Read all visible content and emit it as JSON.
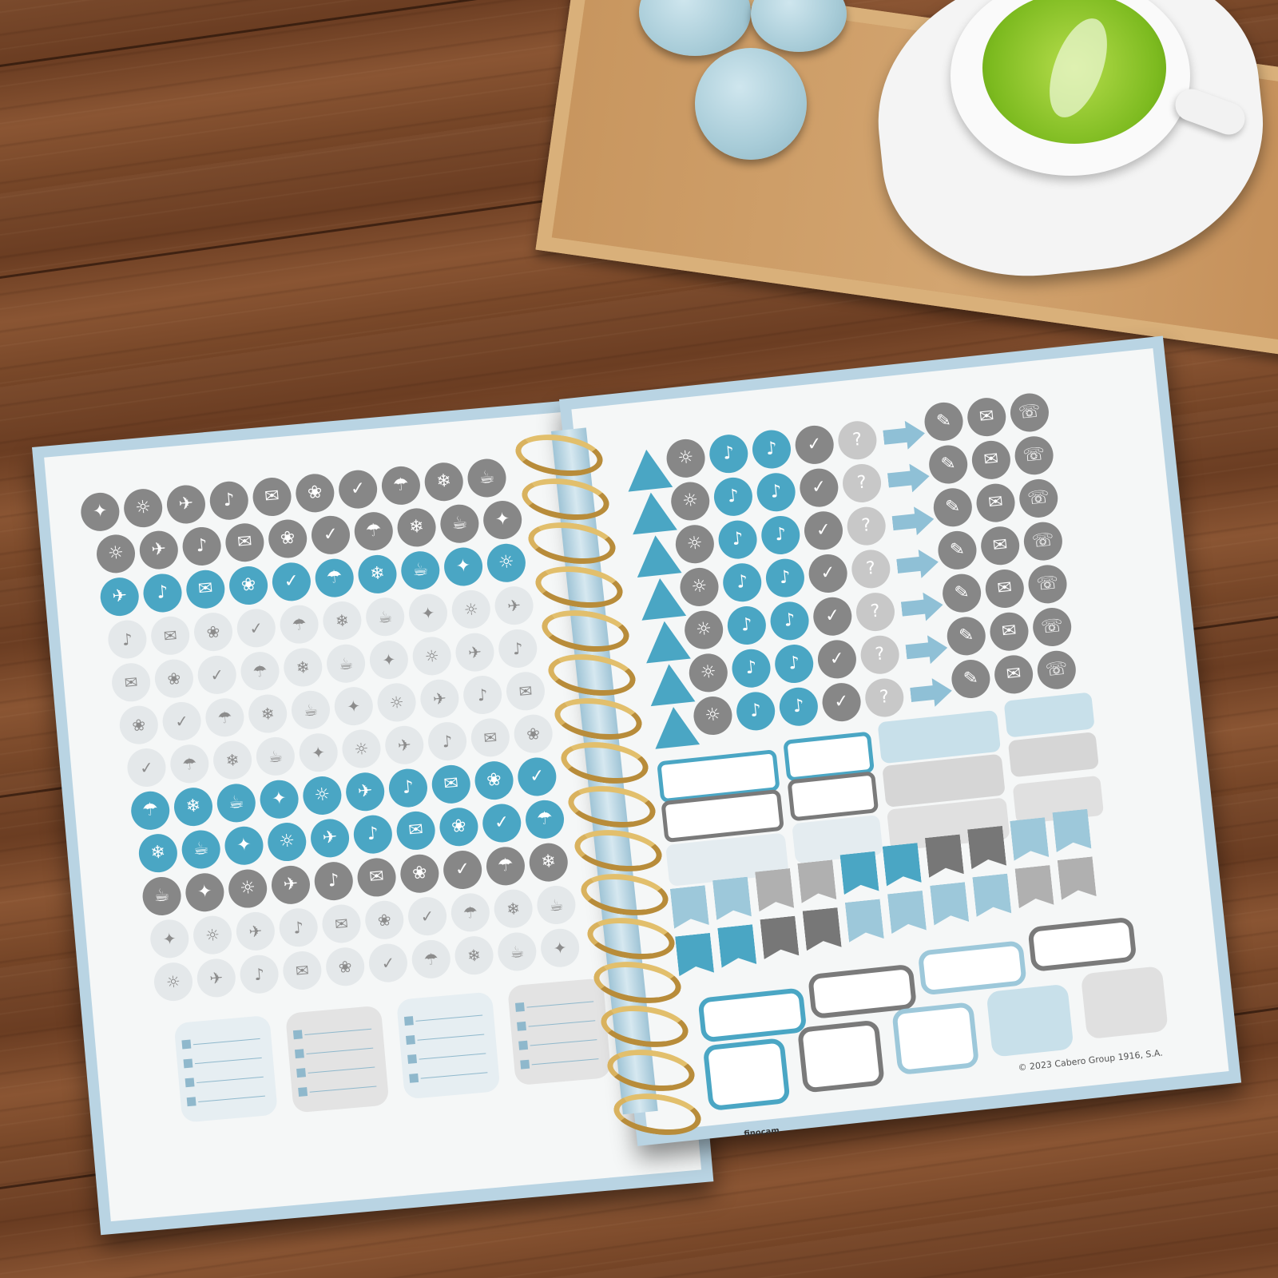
{
  "scene": {
    "copyright_text": "© 2023 Cabero Group 1916, S.A.",
    "brand_text": "finocam"
  },
  "palette": {
    "blue": "#4aa6c4",
    "gray": "#878787",
    "light_gray": "#e4e8ea",
    "light_blue": "#c8e0ea"
  },
  "icons": {
    "left_page_rows": [
      [
        "weightlifting-icon",
        "yoga-icon",
        "swimming-icon",
        "cycling-icon",
        "running-icon"
      ],
      [
        "suitcase-icon",
        "airplane-icon",
        "camper-van-icon",
        "car-icon"
      ],
      [
        "birthday-cake-icon",
        "pumpkin-icon",
        "party-hat-icon",
        "mask-icon",
        "crown-icon",
        "balloons-icon",
        "gift-icon"
      ],
      [
        "champagne-glasses-icon",
        "bunting-icon",
        "coffee-cup-icon",
        "handshake-icon",
        "map-pin-icon",
        "meeting-icon"
      ],
      [
        "cutlery-icon",
        "popcorn-icon",
        "theater-masks-icon",
        "tickets-icon",
        "video-icon",
        "music-note-icon"
      ],
      [
        "sun-icon",
        "rain-cloud-icon",
        "snowflake-icon",
        "beach-icon",
        "mountains-icon"
      ],
      [
        "basket-icon",
        "stethoscope-icon",
        "hand-icon",
        "laundry-icon",
        "scissors-icon",
        "tools-icon"
      ]
    ],
    "right_page_rows": [
      "warning-icon",
      "lightbulb-icon",
      "bell-icon",
      "checkmark-icon",
      "question-mark-icon",
      "arrow-right-icon",
      "notepad-icon",
      "envelope-icon",
      "phone-icon"
    ]
  }
}
